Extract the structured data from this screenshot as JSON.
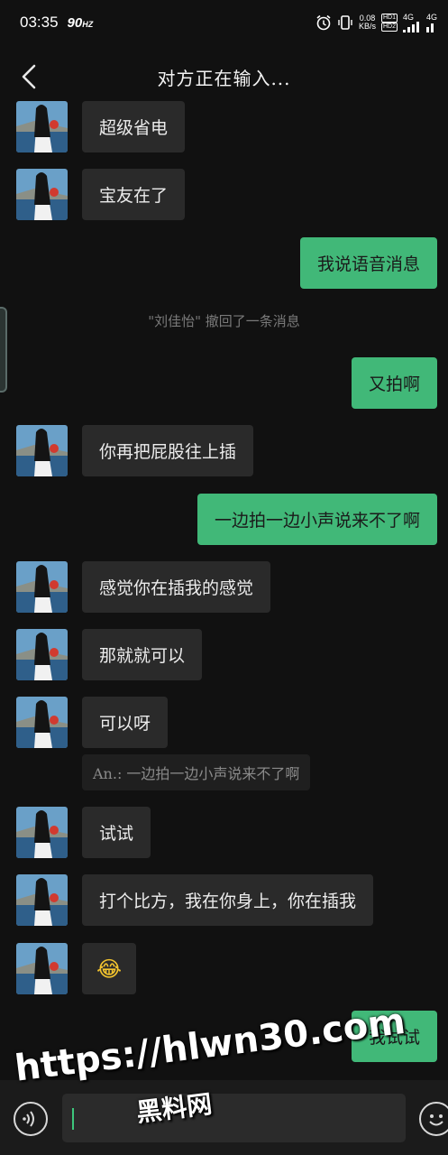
{
  "status_bar": {
    "time": "03:35",
    "refresh": "90",
    "refresh_unit": "HZ",
    "speed_value": "0.08",
    "speed_unit": "KB/s",
    "hd1": "HD1",
    "hd2": "HD2",
    "net1": "4G",
    "net2": "4G"
  },
  "header": {
    "title": "对方正在输入..."
  },
  "messages": [
    {
      "side": "in",
      "text": "超级省电"
    },
    {
      "side": "in",
      "text": "宝友在了"
    },
    {
      "side": "out",
      "text": "我说语音消息"
    },
    {
      "side": "system",
      "text": "\"刘佳怡\" 撤回了一条消息"
    },
    {
      "side": "out",
      "text": "又拍啊"
    },
    {
      "side": "in",
      "text": "你再把屁股往上插"
    },
    {
      "side": "out",
      "text": "一边拍一边小声说来不了啊"
    },
    {
      "side": "in",
      "text": "感觉你在插我的感觉"
    },
    {
      "side": "in",
      "text": "那就就可以"
    },
    {
      "side": "in",
      "text": "可以呀"
    },
    {
      "side": "quote",
      "text": "An.: 一边拍一边小声说来不了啊"
    },
    {
      "side": "in",
      "text": "试试"
    },
    {
      "side": "in",
      "text": "打个比方，我在你身上，你在插我"
    },
    {
      "side": "in",
      "text": "😂"
    },
    {
      "side": "out",
      "text": "我试试"
    }
  ],
  "watermark": {
    "line1": "https://hlwn30.com",
    "line2": "黑料网"
  },
  "colors": {
    "background": "#111111",
    "incoming_bubble": "#2a2a2a",
    "outgoing_bubble": "#41b878",
    "caret": "#3dc77c"
  },
  "icons": {
    "back": "chevron-left-icon",
    "voice": "voice-input-icon",
    "emoji": "emoji-icon",
    "alarm": "alarm-icon",
    "vibrate": "vibrate-icon",
    "signal": "signal-icon"
  }
}
